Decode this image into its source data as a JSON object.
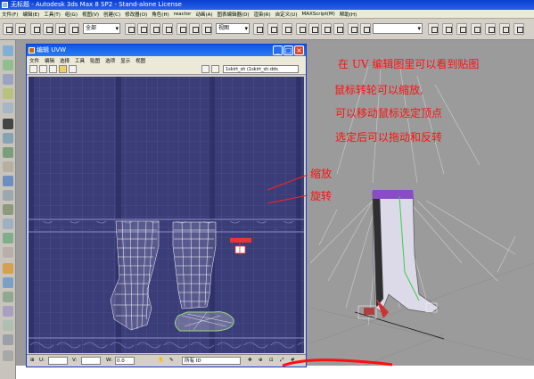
{
  "app": {
    "title": "无标题 - Autodesk 3ds Max 8 SP2 - Stand-alone License",
    "menus": [
      "文件(F)",
      "编辑(E)",
      "工具(T)",
      "组(G)",
      "视图(V)",
      "创建(C)",
      "修改器(O)",
      "角色(H)",
      "reactor",
      "动画(A)",
      "图表编辑器(D)",
      "渲染(R)",
      "自定义(U)",
      "MAXScript(M)",
      "帮助(H)"
    ]
  },
  "toolbar": {
    "selection_filter": "全部",
    "reference_coord": "视图"
  },
  "uv_window": {
    "title": "编辑 UVW",
    "menus": [
      "文件",
      "编辑",
      "选择",
      "工具",
      "贴图",
      "选项",
      "显示",
      "视图"
    ],
    "map_selector": "1skirt_sh (1skirt_sh.dds",
    "u_label": "U:",
    "v_label": "V:",
    "w_label": "W:",
    "w_value": "0.0",
    "id_filter": "所有 ID"
  },
  "annotations": {
    "line1": "在 UV 编辑图里可以看到贴图",
    "line2": "鼠标转轮可以缩放,",
    "line3": "可以移动鼠标选定顶点",
    "line4": "选定后可以拖动和反转",
    "scale_label": "缩放",
    "rotate_label": "旋转"
  },
  "colors": {
    "uv_background": "#3b3d78",
    "uv_wire": "#ffffff",
    "selected_wire": "#9adf7a",
    "annotation": "#ff1010",
    "viewport_bg": "#9b9b9b",
    "boot_body": "#d9d6e6",
    "boot_trim": "#8a4cc6"
  }
}
